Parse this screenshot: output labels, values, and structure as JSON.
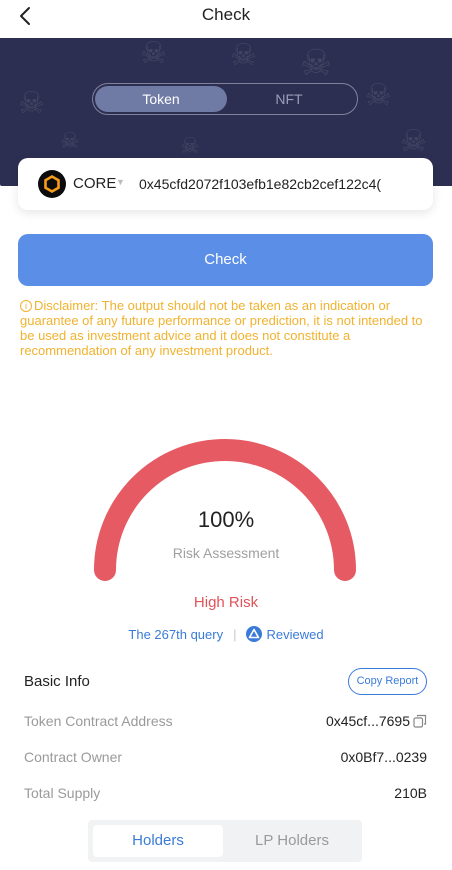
{
  "header": {
    "title": "Check",
    "back_icon": "chevron-left-icon"
  },
  "banner": {
    "background": "#2d2f52",
    "toggle": {
      "active_label": "Token",
      "inactive_label": "NFT"
    }
  },
  "search": {
    "chain_icon": "core-chain-icon",
    "chain_name": "CORE",
    "address_value": "0x45cfd2072f103efb1e82cb2cef122c4("
  },
  "check_button": {
    "label": "Check",
    "color": "#5b8ee6"
  },
  "disclaimer": {
    "icon": "info-icon",
    "text": "Disclaimer: The output should not be taken as an indication or guarantee of any future performance or prediction, it is not intended to be used as investment advice and it does not constitute a recommendation of any investment product.",
    "color": "#f1b22f"
  },
  "gauge": {
    "value_text": "100%",
    "value": 1.0,
    "label": "Risk Assessment",
    "arc_color": "#e65a63"
  },
  "risk": {
    "level": "High Risk",
    "color": "#e0535a"
  },
  "query": {
    "count_text": "The 267th query",
    "separator": "|",
    "review_icon": "shield-check-icon",
    "review_text": "Reviewed"
  },
  "basic_info": {
    "title": "Basic Info",
    "copy_button": "Copy Report",
    "rows": [
      {
        "label": "Token Contract Address",
        "value": "0x45cf...7695",
        "icon": "copy-icon"
      },
      {
        "label": "Contract Owner",
        "value": "0x0Bf7...0239"
      },
      {
        "label": "Total Supply",
        "value": "210B"
      }
    ]
  },
  "tabs": {
    "active": "Holders",
    "inactive": "LP Holders"
  }
}
